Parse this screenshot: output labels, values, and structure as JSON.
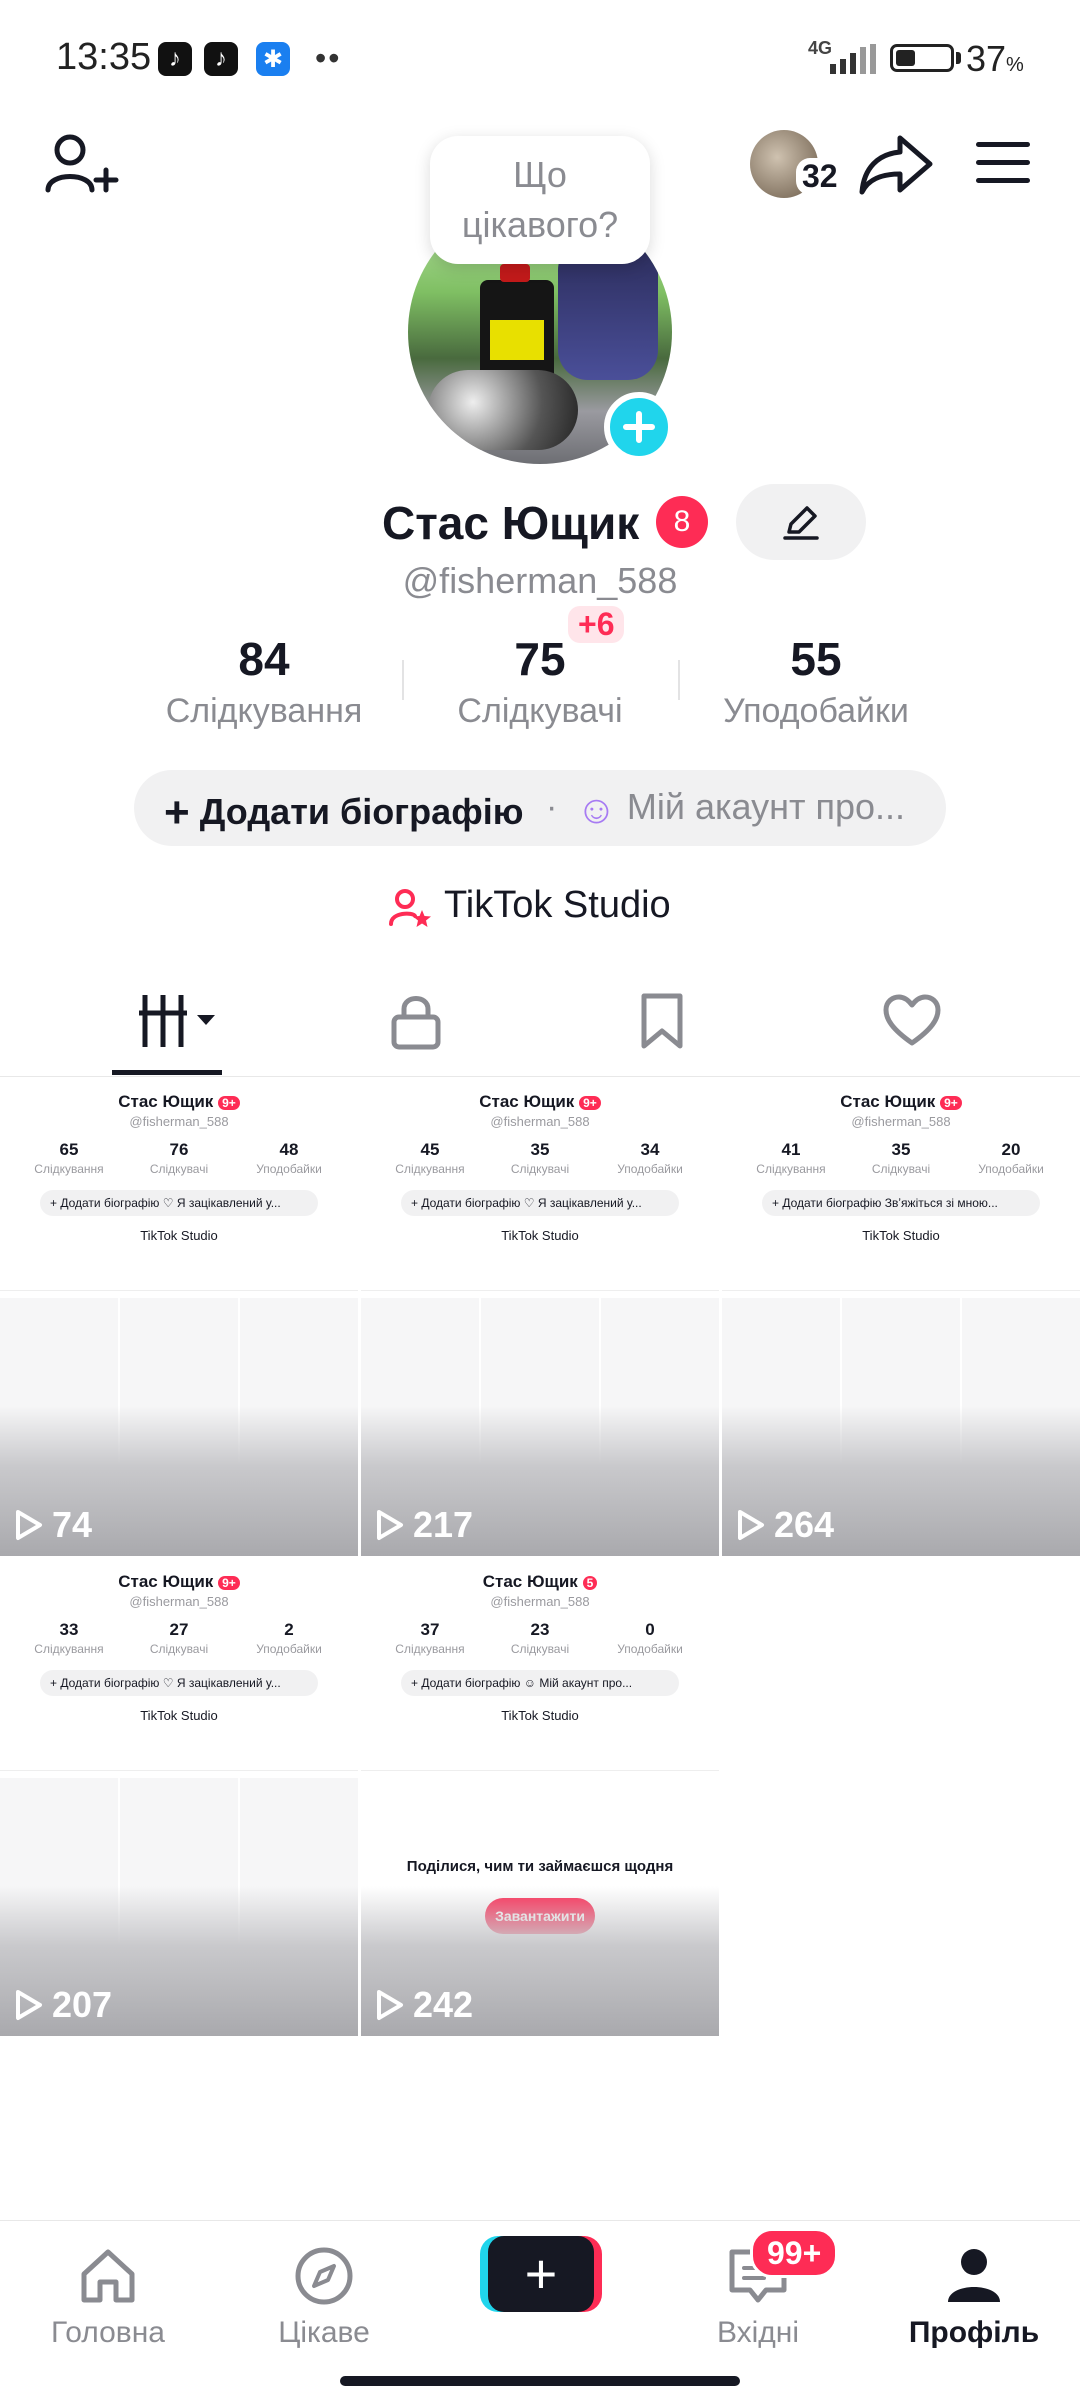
{
  "status_bar": {
    "time": "13:35",
    "network": "4G",
    "battery_text": "37",
    "battery_unit": "%",
    "battery_level": 0.37,
    "dots": "••"
  },
  "header": {
    "visitors_count": "32"
  },
  "bubble": {
    "text": "Що цікавого?"
  },
  "profile": {
    "name": "Стас Ющик",
    "name_badge": "8",
    "handle": "@fisherman_588"
  },
  "stats": [
    {
      "value": "84",
      "label": "Слідкування"
    },
    {
      "value": "75",
      "label": "Слідкувачі",
      "delta": "+6"
    },
    {
      "value": "55",
      "label": "Уподобайки"
    }
  ],
  "bio": {
    "add_label": "Додати біографію",
    "separator": "·",
    "account_label": "Мій акаунт про..."
  },
  "studio": {
    "label": "TikTok Studio"
  },
  "videos": [
    {
      "views": "74",
      "mini": {
        "name": "Стас Ющик",
        "badge": "9+",
        "handle": "@fisherman_588",
        "stats": [
          [
            "65",
            "Слідкування"
          ],
          [
            "76",
            "Слідкувачі"
          ],
          [
            "48",
            "Уподобайки"
          ]
        ],
        "bio": "+ Додати біографію  ♡ Я зацікавлений у...",
        "studio": "TikTok Studio"
      }
    },
    {
      "views": "217",
      "mini": {
        "name": "Стас Ющик",
        "badge": "9+",
        "handle": "@fisherman_588",
        "stats": [
          [
            "45",
            "Слідкування"
          ],
          [
            "35",
            "Слідкувачі"
          ],
          [
            "34",
            "Уподобайки"
          ]
        ],
        "bio": "+ Додати біографію  ♡ Я зацікавлений у...",
        "studio": "TikTok Studio"
      }
    },
    {
      "views": "264",
      "mini": {
        "name": "Стас Ющик",
        "badge": "9+",
        "handle": "@fisherman_588",
        "stats": [
          [
            "41",
            "Слідкування"
          ],
          [
            "35",
            "Слідкувачі"
          ],
          [
            "20",
            "Уподобайки"
          ]
        ],
        "bio": "+ Додати біографію  Звʼяжіться зі мною...",
        "studio": "TikTok Studio"
      }
    },
    {
      "views": "207",
      "mini": {
        "name": "Стас Ющик",
        "badge": "9+",
        "handle": "@fisherman_588",
        "stats": [
          [
            "33",
            "Слідкування"
          ],
          [
            "27",
            "Слідкувачі"
          ],
          [
            "2",
            "Уподобайки"
          ]
        ],
        "bio": "+ Додати біографію  ♡ Я зацікавлений у...",
        "studio": "TikTok Studio"
      }
    },
    {
      "views": "242",
      "mini": {
        "name": "Стас Ющик",
        "badge": "5",
        "handle": "@fisherman_588",
        "stats": [
          [
            "37",
            "Слідкування"
          ],
          [
            "23",
            "Слідкувачі"
          ],
          [
            "0",
            "Уподобайки"
          ]
        ],
        "bio": "+ Додати біографію  ☺ Мій акаунт про...",
        "studio": "TikTok Studio",
        "empty_text": "Поділися, чим ти займаєшся щодня",
        "upload_label": "Завантажити"
      }
    }
  ],
  "nav": {
    "home": "Головна",
    "explore": "Цікаве",
    "inbox": "Вхідні",
    "inbox_badge": "99+",
    "profile": "Профіль"
  },
  "colors": {
    "accent": "#fe2c55",
    "cyan": "#20d5ec",
    "text": "#161823",
    "muted": "#8a8b91"
  }
}
